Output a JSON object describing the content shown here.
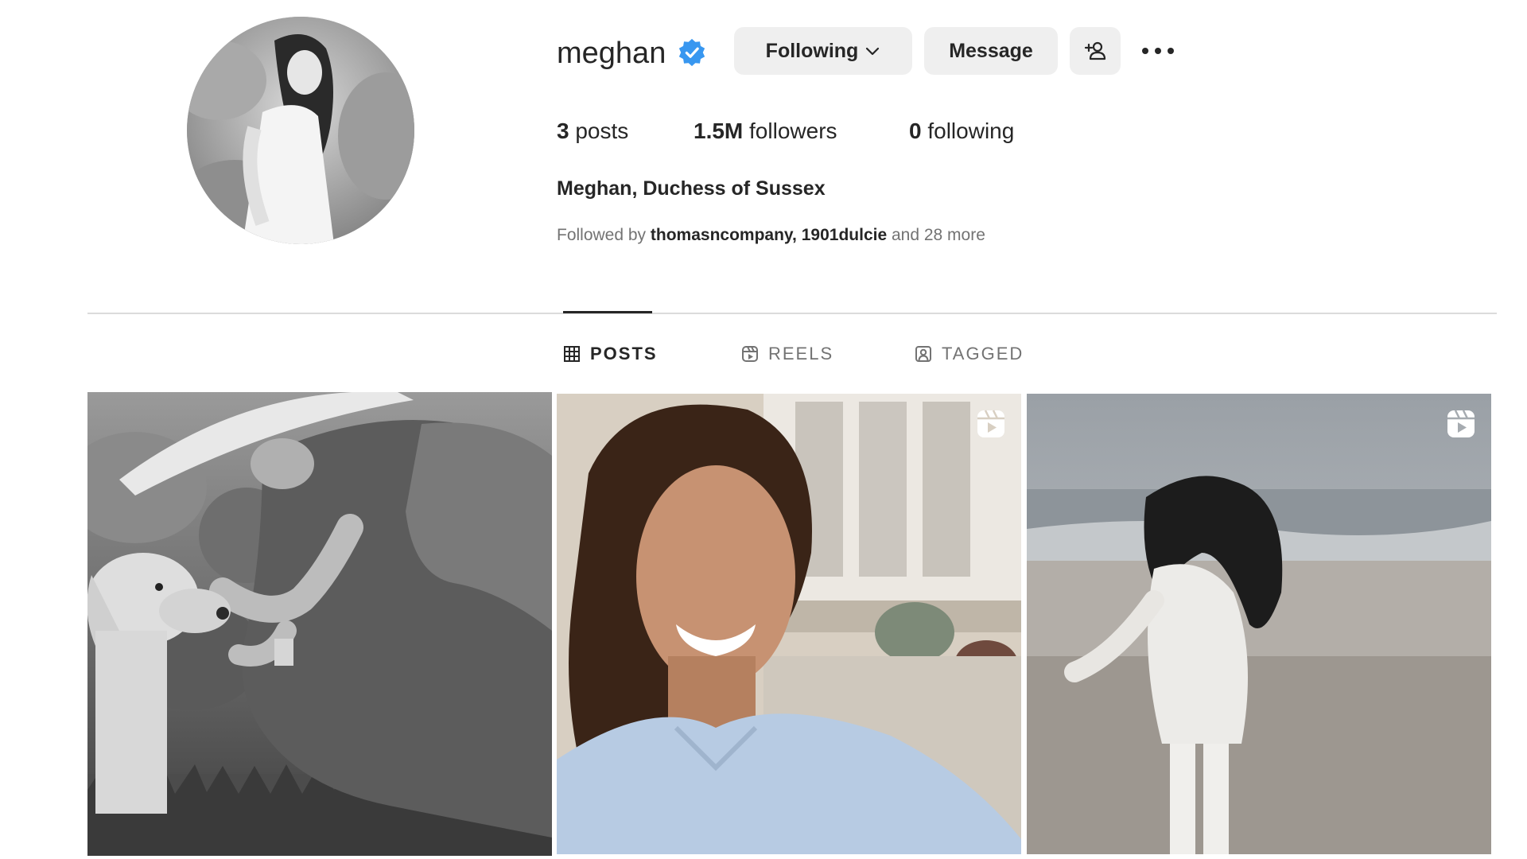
{
  "profile": {
    "username": "meghan",
    "verified_icon": "verified-badge-icon",
    "full_name": "Meghan, Duchess of Sussex",
    "avatar": "profile-photo-grayscale"
  },
  "actions": {
    "following_label": "Following",
    "message_label": "Message",
    "add_user_icon": "add-user-icon",
    "more_icon": "more-options-icon"
  },
  "stats": {
    "posts_count": "3",
    "posts_label": "posts",
    "followers_count": "1.5M",
    "followers_label": "followers",
    "following_count": "0",
    "following_label": "following"
  },
  "followed_by": {
    "prefix": "Followed by",
    "user1": "thomasncompany,",
    "user2": "1901dulcie",
    "suffix": "and 28 more"
  },
  "tabs": [
    {
      "label": "POSTS",
      "icon": "grid-icon",
      "active": true
    },
    {
      "label": "REELS",
      "icon": "reels-icon",
      "active": false
    },
    {
      "label": "TAGGED",
      "icon": "tagged-icon",
      "active": false
    }
  ],
  "posts": [
    {
      "kind": "photo",
      "description_icon": "post-thumbnail"
    },
    {
      "kind": "reel",
      "description_icon": "reel-thumbnail"
    },
    {
      "kind": "reel",
      "description_icon": "reel-thumbnail"
    }
  ],
  "colors": {
    "verified_blue": "#3897f0",
    "button_bg": "#efefef",
    "text_primary": "#262626",
    "text_secondary": "#737373",
    "divider": "#dbdbdb"
  }
}
